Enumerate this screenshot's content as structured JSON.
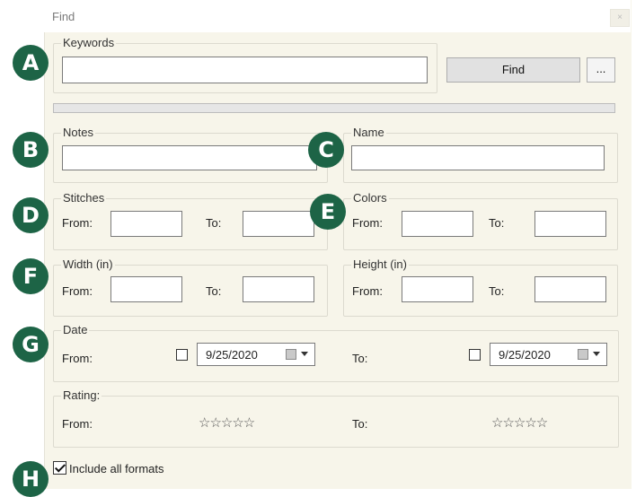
{
  "window": {
    "title": "Find",
    "close_glyph": "×"
  },
  "keywords": {
    "legend": "Keywords",
    "value": "",
    "find_label": "Find",
    "more_label": "..."
  },
  "progress": {
    "fraction": 0.0
  },
  "notes": {
    "legend": "Notes",
    "value": ""
  },
  "name": {
    "legend": "Name",
    "value": ""
  },
  "stitches": {
    "legend": "Stitches",
    "from_label": "From:",
    "to_label": "To:",
    "from_value": "",
    "to_value": ""
  },
  "colors": {
    "legend": "Colors",
    "from_label": "From:",
    "to_label": "To:",
    "from_value": "",
    "to_value": ""
  },
  "width": {
    "legend": "Width (in)",
    "from_label": "From:",
    "to_label": "To:",
    "from_value": "",
    "to_value": ""
  },
  "height": {
    "legend": "Height (in)",
    "from_label": "From:",
    "to_label": "To:",
    "from_value": "",
    "to_value": ""
  },
  "date": {
    "legend": "Date",
    "from_label": "From:",
    "to_label": "To:",
    "from_date": "9/25/2020",
    "to_date": "9/25/2020",
    "from_checked": false,
    "to_checked": false
  },
  "rating": {
    "legend": "Rating:",
    "from_label": "From:",
    "to_label": "To:",
    "from_stars": "☆☆☆☆☆",
    "to_stars": "☆☆☆☆☆"
  },
  "include_all_formats": {
    "label": "Include all formats",
    "checked": true
  },
  "annotations": {
    "a": "A",
    "b": "B",
    "c": "C",
    "d": "D",
    "e": "E",
    "f": "F",
    "g": "G",
    "h": "H",
    "badge_color": "#1d6446"
  }
}
